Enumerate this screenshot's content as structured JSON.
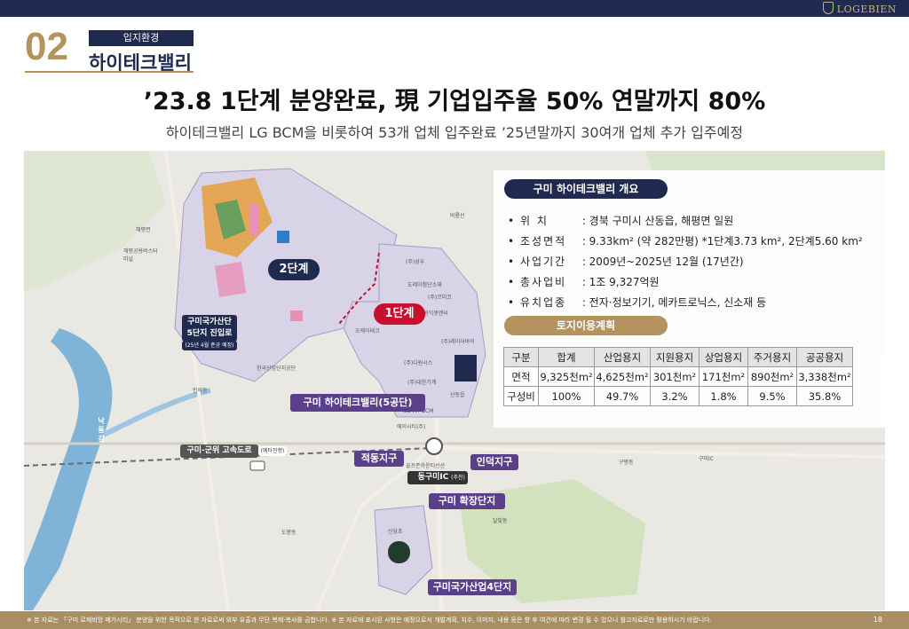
{
  "brand": {
    "logo": "LOGEBIEN"
  },
  "section": {
    "number": "02",
    "tag": "입지환경",
    "title": "하이테크밸리"
  },
  "headline": "’23.8 1단계 분양완료, 現 기업입주율 50% 연말까지 80%",
  "subline": "하이테크밸리 LG BCM을 비롯하여 53개 업체 입주완료 ’25년말까지 30여개 업체 추가 입주예정",
  "overview": {
    "title": "구미 하이테크밸리 개요",
    "rows": [
      {
        "key": "위 치",
        "value": "경북 구미시 산동읍, 해평면 일원"
      },
      {
        "key": "조성면적",
        "value": "9.33km² (약 282만평) *1단계3.73 km², 2단계5.60 km²"
      },
      {
        "key": "사업기간",
        "value": "2009년~2025년 12월 (17년간)"
      },
      {
        "key": "총사업비",
        "value": "1조 9,327억원"
      },
      {
        "key": "유치업종",
        "value": "전자·정보기기, 메카트로닉스, 신소재 등"
      }
    ]
  },
  "land_use": {
    "title": "토지이용계획",
    "headers": [
      "구분",
      "합계",
      "산업용지",
      "지원용지",
      "상업용지",
      "주거용지",
      "공공용지"
    ],
    "rows": [
      [
        "면적",
        "9,325천m²",
        "4,625천m²",
        "301천m²",
        "171천m²",
        "890천m²",
        "3,338천m²"
      ],
      [
        "구성비",
        "100%",
        "49.7%",
        "3.2%",
        "1.8%",
        "9.5%",
        "35.8%"
      ]
    ]
  },
  "map": {
    "labels": {
      "phase2": "2단계",
      "phase1": "1단계",
      "ic_entry": "구미국가산단\n5단지 진입로",
      "ic_entry_note": "(25년 4월 준공 예정)",
      "hitech5": "구미 하이테크밸리(5공단)",
      "highway": "구미-군위 고속도로",
      "highway_note": "(예타진행)",
      "jeokdong": "적동지구",
      "indeok": "인덕지구",
      "dongtgumi_ic": "동구미IC",
      "dongtgumi_ic_note": "(추진)",
      "expansion": "구미 확장단지",
      "industrial4": "구미국가산업4단지",
      "river": "낙동강"
    },
    "small_labels": [
      "해평면",
      "해평공용버스터미널",
      "비룡산",
      "도레이첨단소재",
      "(주)성우",
      "(주)원익큐엔씨",
      "(주)코미코",
      "도레이배터리세퍼레이터",
      "(주)레이어바이",
      "(주)다원시스",
      "(주)대원산업",
      "LG이노텍",
      "(주)대한기계",
      "LG·HY BCM",
      "에이시티(주)",
      "한국산업단지공단",
      "오케이테크",
      "구미공단",
      "산동읍",
      "선주원남동",
      "인의동",
      "진평동",
      "구미IC",
      "구평동",
      "옥계동",
      "임은동",
      "낙동강체육공원",
      "양포동",
      "도봉동",
      "달빛동",
      "골프존카운티선산",
      "산동초등학교",
      "구미확장단지",
      "산업단지공단",
      "구미4단지",
      "신당초",
      "해평역",
      "봉곡동"
    ]
  },
  "footer": {
    "note": "※ 본 자료는 「구미 로제비앙 메가시티」 분양을 위한 목적으로 한 자료로써 외부 유출과 무단 복제·복사를 금합니다. ※ 본 자료에 표시된 사항은 예정으로서 개발계획, 치수, 이미지, 내용 등은 향 후 여건에 따라 변경 될 수 있으니 참고자료로만 활용하시기 바랍니다.",
    "page": "18"
  },
  "colors": {
    "navy": "#1f2a4e",
    "gold": "#b4935e",
    "phase1": "#c8102e",
    "purple": "#5b3f8a"
  }
}
